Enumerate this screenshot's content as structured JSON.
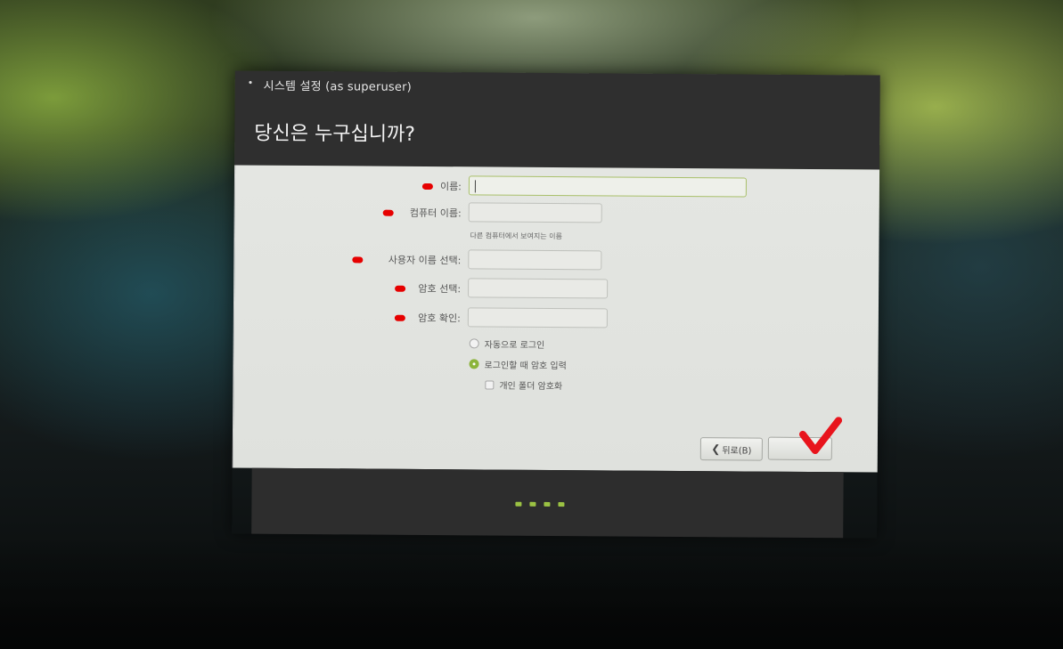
{
  "window": {
    "title": "시스템 설정 (as superuser)",
    "heading": "당신은 누구십니까?"
  },
  "form": {
    "name": {
      "label": "이름:",
      "value": ""
    },
    "computer_name": {
      "label": "컴퓨터 이름:",
      "value": "",
      "hint": "다른 컴퓨터에서 보여지는 이름"
    },
    "username": {
      "label": "사용자 이름 선택:",
      "value": ""
    },
    "password": {
      "label": "암호 선택:",
      "value": ""
    },
    "confirm": {
      "label": "암호 확인:",
      "value": ""
    },
    "options": {
      "auto_login": "자동으로 로그인",
      "require_password": "로그인할 때 암호 입력",
      "encrypt_home": "개인 폴더 암호화"
    }
  },
  "buttons": {
    "back": "뒤로(B)",
    "forward": ""
  },
  "colors": {
    "accent": "#8cb43c",
    "required_marker": "#e60000",
    "annotation": "#e8141c",
    "titlebar": "#2f2f2f",
    "content_bg": "#e4e6e2"
  },
  "progress": {
    "total_steps": 4
  }
}
